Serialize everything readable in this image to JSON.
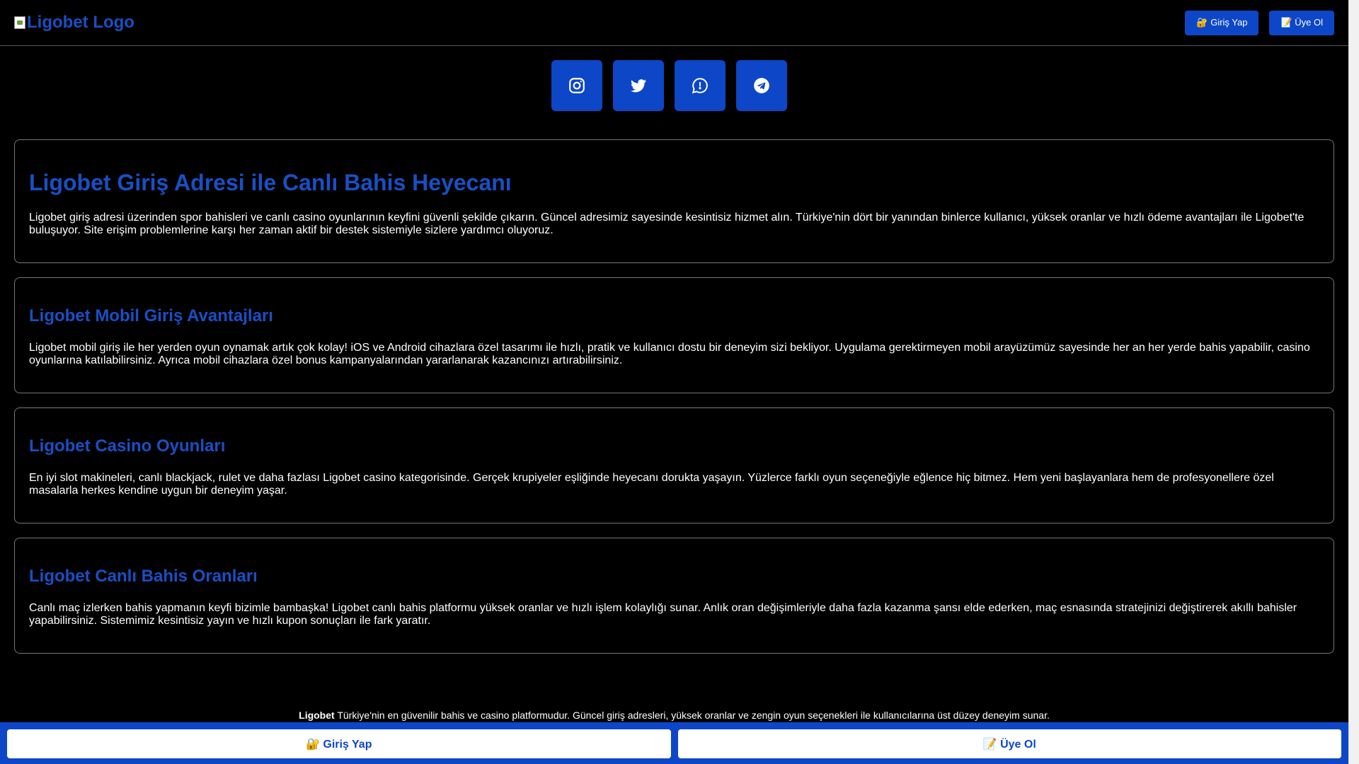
{
  "header": {
    "logo_alt": "Ligobet Logo",
    "login_label": "🔐 Giriş Yap",
    "register_label": "📝 Üye Ol"
  },
  "socials": [
    {
      "name": "instagram-icon"
    },
    {
      "name": "twitter-icon"
    },
    {
      "name": "whatsapp-icon"
    },
    {
      "name": "telegram-icon"
    }
  ],
  "sections": [
    {
      "title": "Ligobet Giriş Adresi ile Canlı Bahis Heyecanı",
      "text": "Ligobet giriş adresi üzerinden spor bahisleri ve canlı casino oyunlarının keyfini güvenli şekilde çıkarın. Güncel adresimiz sayesinde kesintisiz hizmet alın. Türkiye'nin dört bir yanından binlerce kullanıcı, yüksek oranlar ve hızlı ödeme avantajları ile Ligobet'te buluşuyor. Site erişim problemlerine karşı her zaman aktif bir destek sistemiyle sizlere yardımcı oluyoruz."
    },
    {
      "title": "Ligobet Mobil Giriş Avantajları",
      "text": "Ligobet mobil giriş ile her yerden oyun oynamak artık çok kolay! iOS ve Android cihazlara özel tasarımı ile hızlı, pratik ve kullanıcı dostu bir deneyim sizi bekliyor. Uygulama gerektirmeyen mobil arayüzümüz sayesinde her an her yerde bahis yapabilir, casino oyunlarına katılabilirsiniz. Ayrıca mobil cihazlara özel bonus kampanyalarından yararlanarak kazancınızı artırabilirsiniz."
    },
    {
      "title": "Ligobet Casino Oyunları",
      "text": "En iyi slot makineleri, canlı blackjack, rulet ve daha fazlası Ligobet casino kategorisinde. Gerçek krupiyeler eşliğinde heyecanı dorukta yaşayın. Yüzlerce farklı oyun seçeneğiyle eğlence hiç bitmez. Hem yeni başlayanlara hem de profesyonellere özel masalarla herkes kendine uygun bir deneyim yaşar."
    },
    {
      "title": "Ligobet Canlı Bahis Oranları",
      "text": "Canlı maç izlerken bahis yapmanın keyfi bizimle bambaşka! Ligobet canlı bahis platformu yüksek oranlar ve hızlı işlem kolaylığı sunar. Anlık oran değişimleriyle daha fazla kazanma şansı elde ederken, maç esnasında stratejinizi değiştirerek akıllı bahisler yapabilirsiniz. Sistemimiz kesintisiz yayın ve hızlı kupon sonuçları ile fark yaratır."
    }
  ],
  "footer": {
    "brand": "Ligobet",
    "text": " Türkiye'nin en güvenilir bahis ve casino platformudur. Güncel giriş adresleri, yüksek oranlar ve zengin oyun seçenekleri ile kullanıcılarına üst düzey deneyim sunar."
  },
  "bottom_bar": {
    "login_label": "🔐 Giriş Yap",
    "register_label": "📝 Üye Ol"
  },
  "colors": {
    "accent": "#0d47c7",
    "heading": "#1a4fc4",
    "background": "#000000"
  }
}
